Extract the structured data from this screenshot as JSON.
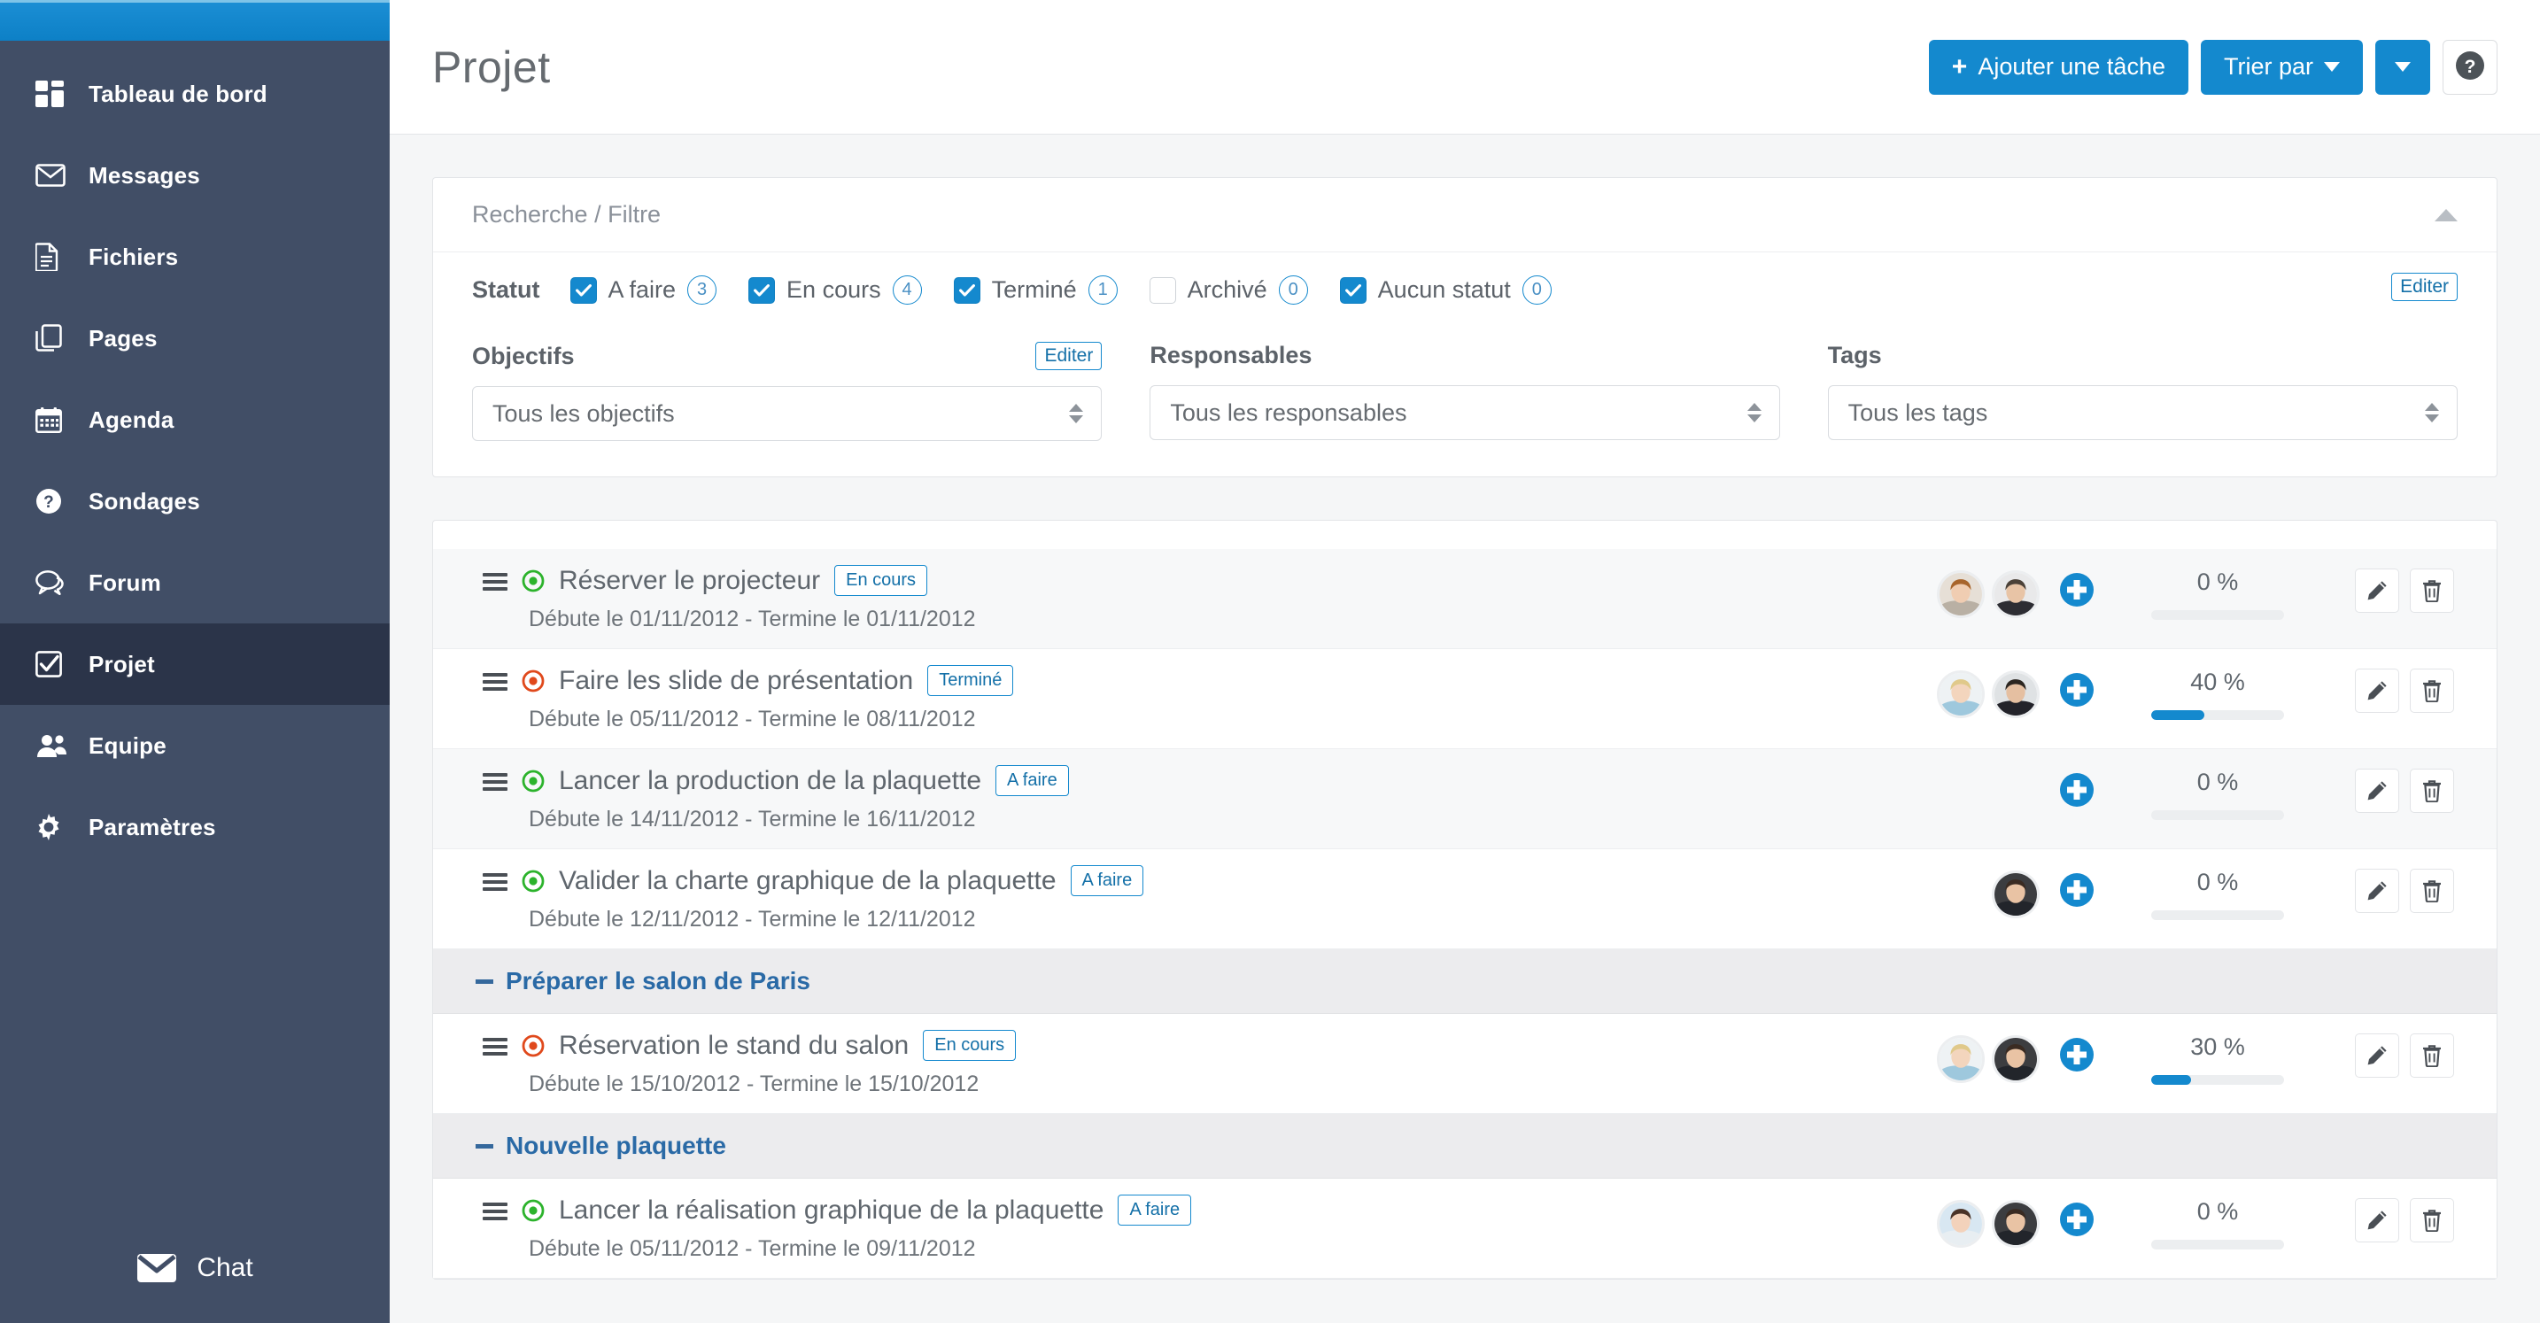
{
  "sidebar": {
    "items": [
      {
        "label": "Tableau de bord",
        "icon": "dashboard-icon",
        "active": false
      },
      {
        "label": "Messages",
        "icon": "envelope-icon",
        "active": false
      },
      {
        "label": "Fichiers",
        "icon": "file-icon",
        "active": false
      },
      {
        "label": "Pages",
        "icon": "pages-icon",
        "active": false
      },
      {
        "label": "Agenda",
        "icon": "calendar-icon",
        "active": false
      },
      {
        "label": "Sondages",
        "icon": "question-circle-icon",
        "active": false
      },
      {
        "label": "Forum",
        "icon": "comments-icon",
        "active": false
      },
      {
        "label": "Projet",
        "icon": "check-square-icon",
        "active": true
      },
      {
        "label": "Equipe",
        "icon": "users-icon",
        "active": false
      },
      {
        "label": "Paramètres",
        "icon": "gear-icon",
        "active": false
      }
    ],
    "chat": {
      "label": "Chat",
      "icon": "envelope-icon"
    }
  },
  "header": {
    "title": "Projet",
    "add_task_label": "Ajouter une tâche",
    "add_task_plus": "+",
    "sort_label": "Trier par",
    "help_label": "?"
  },
  "filter": {
    "panel_title": "Recherche / Filtre",
    "status_label": "Statut",
    "edit_label": "Editer",
    "statuses": [
      {
        "label": "A faire",
        "count": "3",
        "checked": true
      },
      {
        "label": "En cours",
        "count": "4",
        "checked": true
      },
      {
        "label": "Terminé",
        "count": "1",
        "checked": true
      },
      {
        "label": "Archivé",
        "count": "0",
        "checked": false
      },
      {
        "label": "Aucun statut",
        "count": "0",
        "checked": true
      }
    ],
    "selects": [
      {
        "label": "Objectifs",
        "value": "Tous les objectifs",
        "has_edit": true
      },
      {
        "label": "Responsables",
        "value": "Tous les responsables",
        "has_edit": false
      },
      {
        "label": "Tags",
        "value": "Tous les tags",
        "has_edit": false
      }
    ]
  },
  "tasks": {
    "rows": [
      {
        "kind": "task",
        "alt": true,
        "title": "Réserver le projecteur",
        "badge": "En cours",
        "dot_color": "#2cb32c",
        "dates": "Débute le 01/11/2012 - Termine le 01/11/2012",
        "percent": "0 %",
        "percent_value": 0,
        "avatars": [
          "woman-1",
          "man-1"
        ]
      },
      {
        "kind": "task",
        "alt": false,
        "title": "Faire les slide de présentation",
        "badge": "Terminé",
        "dot_color": "#e0491c",
        "dates": "Débute le 05/11/2012 - Termine le 08/11/2012",
        "percent": "40 %",
        "percent_value": 40,
        "avatars": [
          "woman-2",
          "man-2"
        ]
      },
      {
        "kind": "task",
        "alt": true,
        "title": "Lancer la production de la plaquette",
        "badge": "A faire",
        "dot_color": "#2cb32c",
        "dates": "Débute le 14/11/2012 - Termine le 16/11/2012",
        "percent": "0 %",
        "percent_value": 0,
        "avatars": []
      },
      {
        "kind": "task",
        "alt": false,
        "title": "Valider la charte graphique de la plaquette",
        "badge": "A faire",
        "dot_color": "#2cb32c",
        "dates": "Débute le 12/11/2012 - Termine le 12/11/2012",
        "percent": "0 %",
        "percent_value": 0,
        "avatars": [
          "man-3"
        ]
      },
      {
        "kind": "group",
        "title": "Préparer le salon de Paris"
      },
      {
        "kind": "task",
        "alt": false,
        "title": "Réservation le stand du salon",
        "badge": "En cours",
        "dot_color": "#e0491c",
        "dates": "Débute le 15/10/2012 - Termine le 15/10/2012",
        "percent": "30 %",
        "percent_value": 30,
        "avatars": [
          "woman-2",
          "man-3"
        ]
      },
      {
        "kind": "group",
        "title": "Nouvelle plaquette"
      },
      {
        "kind": "task",
        "alt": false,
        "title": "Lancer la réalisation graphique de la plaquette",
        "badge": "A faire",
        "dot_color": "#2cb32c",
        "dates": "Débute le 05/11/2012 - Termine le 09/11/2012",
        "percent": "0 %",
        "percent_value": 0,
        "avatars": [
          "woman-3",
          "man-3"
        ]
      }
    ]
  },
  "colors": {
    "accent": "#1489ce",
    "sidebar_bg": "#414e66",
    "sidebar_active": "#2b3449",
    "topband": "#0f87d0",
    "green_dot": "#2cb32c",
    "red_dot": "#e0491c",
    "group_link": "#2a6aa6"
  }
}
